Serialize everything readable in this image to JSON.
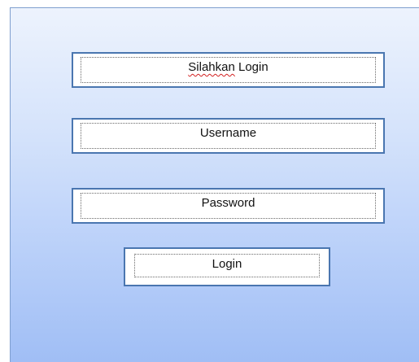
{
  "form": {
    "title_word1": "Silahkan",
    "title_word2": "Login",
    "username_label": "Username",
    "password_label": "Password",
    "login_button_label": "Login"
  },
  "colors": {
    "panel_gradient_top": "#edf3fd",
    "panel_gradient_bottom": "#a0bef5",
    "field_border": "#4a76b0",
    "spellcheck_underline": "#d22020"
  }
}
